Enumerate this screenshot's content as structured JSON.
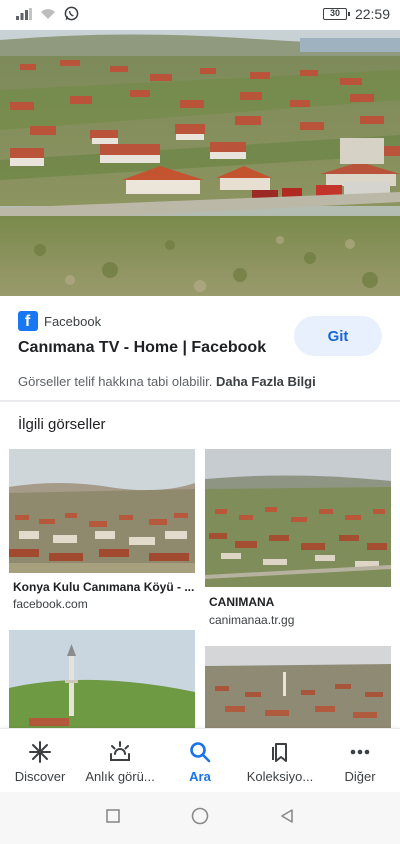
{
  "status": {
    "battery": "30",
    "time": "22:59"
  },
  "result": {
    "source": "Facebook",
    "title": "Canımana TV - Home | Facebook",
    "action": "Git",
    "notice": "Görseller telif hakkına tabi olabilir.",
    "notice_link": "Daha Fazla Bilgi"
  },
  "related": {
    "heading": "İlgili görseller",
    "items": [
      {
        "title": "Konya Kulu Canımana Köyü - ...",
        "source": "facebook.com"
      },
      {
        "title": "CANIMANA",
        "source": "canimanaa.tr.gg"
      },
      {
        "title": "",
        "source": ""
      },
      {
        "title": "",
        "source": ""
      }
    ]
  },
  "nav": {
    "items": [
      {
        "label": "Discover",
        "icon": "asterisk-icon"
      },
      {
        "label": "Anlık görü...",
        "icon": "lens-snap-icon"
      },
      {
        "label": "Ara",
        "icon": "search-icon"
      },
      {
        "label": "Koleksiyo...",
        "icon": "bookmarks-icon"
      },
      {
        "label": "Diğer",
        "icon": "more-dots-icon"
      }
    ],
    "active": "Ara"
  },
  "colors": {
    "accent": "#1a73e8",
    "facebook": "#1877f2",
    "button_bg": "#e8f0fe"
  }
}
